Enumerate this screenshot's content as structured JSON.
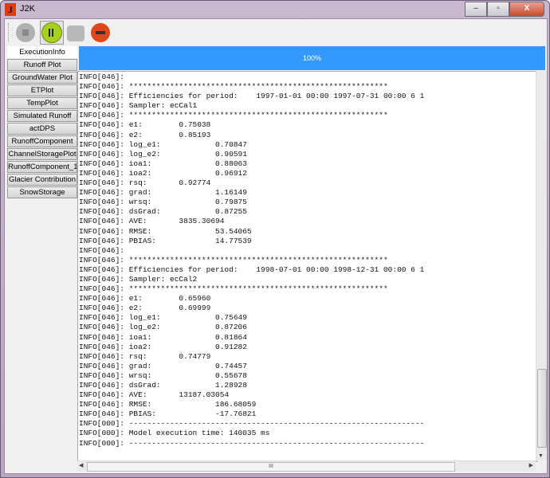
{
  "window": {
    "title": "J2K",
    "icon_letter": "J",
    "minimize": "‒",
    "maximize": "▫",
    "close": "X"
  },
  "toolbar": {
    "buttons": [
      {
        "name": "stop",
        "enabled": false
      },
      {
        "name": "pause",
        "enabled": true
      },
      {
        "name": "save",
        "enabled": false
      },
      {
        "name": "cancel",
        "enabled": true
      }
    ]
  },
  "tabs": [
    "ExecutionInfo",
    "Runoff Plot",
    "GroundWater Plot",
    "ETPlot",
    "TempPlot",
    "Simulated Runoff",
    "actDPS",
    "RunoffComponent",
    "ChannelStoragePlot",
    "RunoffComponent_1",
    "Glacier Contribution",
    "SnowStorage"
  ],
  "active_tab": "ExecutionInfo",
  "progress": {
    "value": 100,
    "label": "100%",
    "color": "#3399ff"
  },
  "log_lines": [
    "INFO[046]:",
    "INFO[046]: *********************************************************",
    "INFO[046]: Efficiencies for period:    1997-01-01 00:00 1997-07-31 00:00 6 1",
    "INFO[046]: Sampler: ecCal1",
    "INFO[046]: *********************************************************",
    "INFO[046]: e1:        0.75038",
    "INFO[046]: e2:        0.85193",
    "INFO[046]: log_e1:            0.70847",
    "INFO[046]: log_e2:            0.90591",
    "INFO[046]: ioa1:              0.88063",
    "INFO[046]: ioa2:              0.96912",
    "INFO[046]: rsq:       0.92774",
    "INFO[046]: grad:              1.16149",
    "INFO[046]: wrsq:              0.79875",
    "INFO[046]: dsGrad:            0.87255",
    "INFO[046]: AVE:       3835.30694",
    "INFO[046]: RMSE:              53.54065",
    "INFO[046]: PBIAS:             14.77539",
    "INFO[046]:",
    "INFO[046]: *********************************************************",
    "INFO[046]: Efficiencies for period:    1998-07-01 00:00 1998-12-31 00:00 6 1",
    "INFO[046]: Sampler: ecCal2",
    "INFO[046]: *********************************************************",
    "INFO[046]: e1:        0.65960",
    "INFO[046]: e2:        0.69999",
    "INFO[046]: log_e1:            0.75649",
    "INFO[046]: log_e2:            0.87206",
    "INFO[046]: ioa1:              0.81864",
    "INFO[046]: ioa2:              0.91282",
    "INFO[046]: rsq:       0.74779",
    "INFO[046]: grad:              0.74457",
    "INFO[046]: wrsq:              0.55678",
    "INFO[046]: dsGrad:            1.28928",
    "INFO[046]: AVE:       13187.03054",
    "INFO[046]: RMSE:              186.68059",
    "INFO[046]: PBIAS:             -17.76821",
    "INFO[000]: -----------------------------------------------------------------",
    "INFO[000]: Model execution time: 140035 ms",
    "INFO[000]: -----------------------------------------------------------------"
  ],
  "scrollbar": {
    "h_grip": "III",
    "v_grip": "≡"
  }
}
